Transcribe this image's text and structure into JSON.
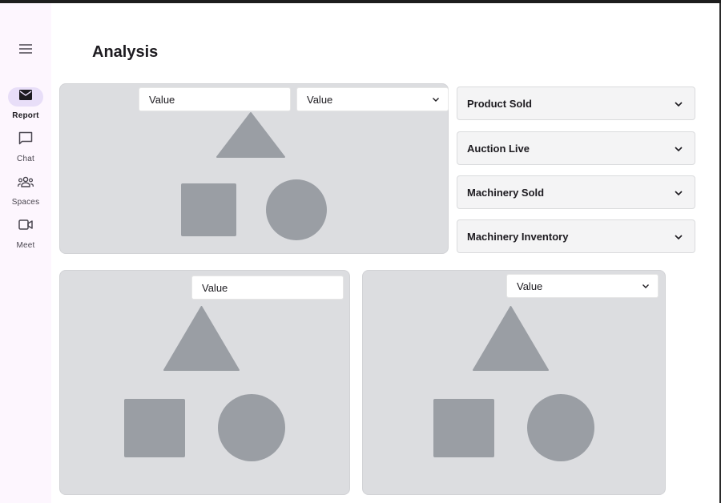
{
  "nav": {
    "menu_icon": "hamburger-menu-icon",
    "items": [
      {
        "label": "Report",
        "icon": "mail-icon",
        "active": true
      },
      {
        "label": "Chat",
        "icon": "chat-bubble-icon",
        "active": false
      },
      {
        "label": "Spaces",
        "icon": "group-icon",
        "active": false
      },
      {
        "label": "Meet",
        "icon": "video-camera-icon",
        "active": false
      }
    ]
  },
  "page": {
    "title": "Analysis"
  },
  "cards": {
    "top": {
      "input_value": "Value",
      "select_value": "Value"
    },
    "bottom_left": {
      "input_value": "Value"
    },
    "bottom_right": {
      "select_value": "Value"
    }
  },
  "accordions": [
    {
      "label": "Product Sold"
    },
    {
      "label": "Auction Live"
    },
    {
      "label": "Machinery Sold"
    },
    {
      "label": "Machinery Inventory"
    }
  ],
  "colors": {
    "rail_bg": "#fdf6fe",
    "active_pill": "#e8def8",
    "card_bg": "#dcdde0",
    "shape_fill": "#9a9ea4"
  }
}
